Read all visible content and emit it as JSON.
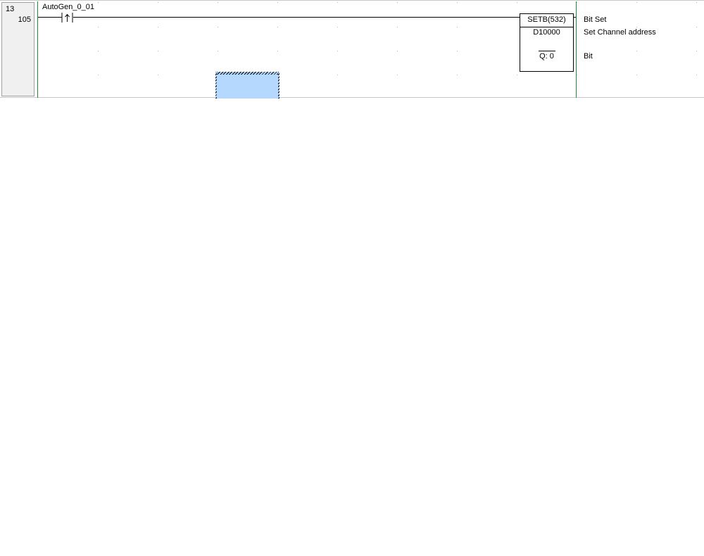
{
  "rung": {
    "number": "13",
    "step": "105"
  },
  "contact": {
    "operand": "AutoGen_0_01",
    "type_icon": "rising-edge-contact-icon"
  },
  "function_block": {
    "name": "SETB(532)",
    "operand1": "D10000",
    "operand2": "Q: 0"
  },
  "comments": {
    "instruction": "Bit Set",
    "operand1": "Set Channel address",
    "operand2": "Bit"
  },
  "colors": {
    "power_rail": "#1f8f2f",
    "selection": "#b4d8fe",
    "header_bg": "#f0f0f0"
  }
}
